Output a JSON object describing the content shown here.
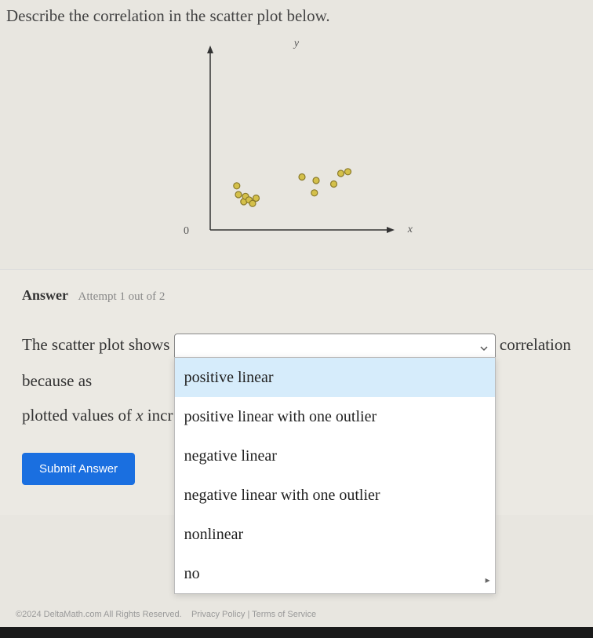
{
  "question": "Describe the correlation in the scatter plot below.",
  "answer_section": {
    "label": "Answer",
    "attempt": "Attempt 1 out of 2"
  },
  "sentence": {
    "part1": "The scatter plot shows",
    "part2": "correlation because as",
    "part3_prefix": "plotted values of ",
    "part3_var": "x",
    "part3_suffix": " incr"
  },
  "dropdown": {
    "selected": "",
    "options": [
      "positive linear",
      "positive linear with one outlier",
      "negative linear",
      "negative linear with one outlier",
      "nonlinear",
      "no"
    ]
  },
  "submit_label": "Submit Answer",
  "footer": {
    "copyright": "©2024 DeltaMath.com All Rights Reserved.",
    "links": "Privacy Policy | Terms of Service"
  },
  "chart": {
    "y_label": "y",
    "x_label": "x",
    "origin": "0"
  },
  "chart_data": {
    "type": "scatter",
    "title": "",
    "xlabel": "x",
    "ylabel": "y",
    "xlim": [
      0,
      10
    ],
    "ylim": [
      0,
      10
    ],
    "series": [
      {
        "name": "points",
        "x": [
          1.5,
          1.6,
          1.9,
          2.0,
          2.2,
          2.4,
          2.6,
          5.2,
          5.9,
          6.0,
          7.0,
          7.4,
          7.8
        ],
        "y": [
          2.5,
          2.0,
          1.6,
          1.9,
          1.7,
          1.5,
          1.8,
          3.0,
          2.1,
          2.8,
          2.6,
          3.2,
          3.3
        ]
      }
    ]
  }
}
